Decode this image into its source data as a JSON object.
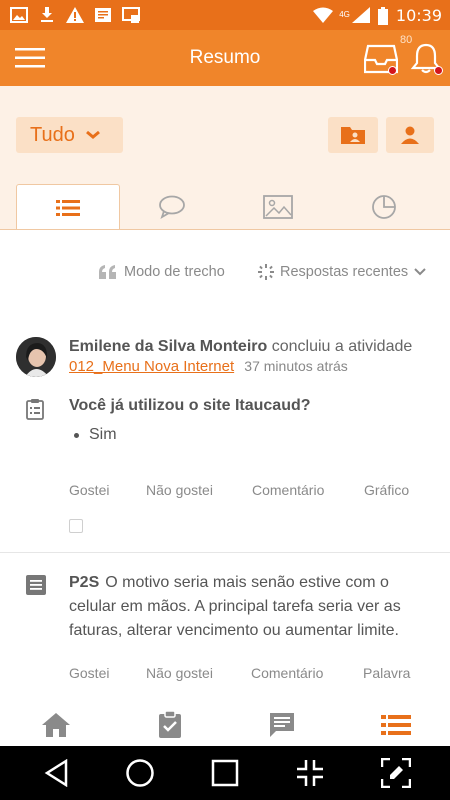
{
  "status_bar": {
    "time": "10:39",
    "signal_label": "4G"
  },
  "app_bar": {
    "title": "Resumo",
    "inbox_count": "80"
  },
  "filter": {
    "scope_label": "Tudo"
  },
  "options": {
    "mode_label": "Modo de trecho",
    "sort_label": "Respostas recentes"
  },
  "feed": [
    {
      "author": "Emilene da Silva Monteiro",
      "verb": "concluiu a atividade",
      "activity_link": "012_Menu Nova Internet",
      "time": "37 minutos atrás",
      "question": "Você já utilizou o site Itaucaud?",
      "answer": "Sim",
      "actions": [
        "Gostei",
        "Não gostei",
        "Comentário",
        "Gráfico"
      ]
    },
    {
      "author": "P2S",
      "text": "O motivo seria mais senão estive com o celular em mãos. A principal tarefa seria ver as faturas, alterar vencimento ou aumentar limite.",
      "actions": [
        "Gostei",
        "Não gostei",
        "Comentário",
        "Palavra"
      ]
    }
  ],
  "colors": {
    "accent": "#f0852a",
    "status_bar": "#e8701a",
    "filter_bg": "#fdf1e6",
    "button_bg": "#fbe0c6",
    "badge_red": "#d4161c"
  },
  "icons": {
    "tabs": [
      "list-icon",
      "chat-bubble-icon",
      "image-icon",
      "pie-chart-icon"
    ],
    "bottom_nav": [
      "home-icon",
      "clipboard-check-icon",
      "message-icon",
      "list-icon"
    ],
    "android_nav": [
      "back-icon",
      "home-circle-icon",
      "recents-icon",
      "collapse-icon",
      "edit-screen-icon"
    ]
  }
}
